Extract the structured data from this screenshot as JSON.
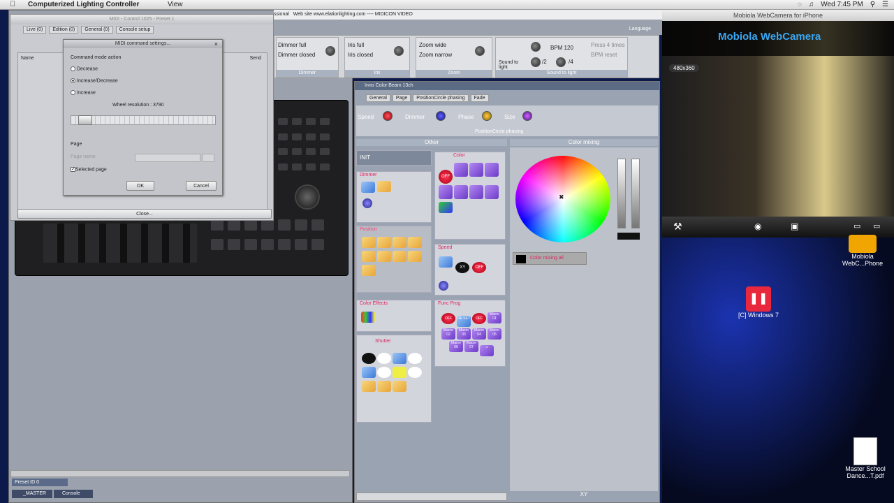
{
  "menubar": {
    "app": "Computerized Lighting Controller",
    "view": "View",
    "clock": "Wed 7:45 PM"
  },
  "midi_window": {
    "title": "MIDI - Control 1025 - Preset 1",
    "tabs": [
      "Live (0)",
      "Edition (0)",
      "General (0)",
      "Console setup"
    ],
    "col_name": "Name",
    "col_send": "Send",
    "close_label": "Close..."
  },
  "dialog": {
    "title": "MIDI command settings...",
    "section": "Command mode action",
    "options": [
      "Decrease",
      "Increase/Decrease",
      "Increase"
    ],
    "selected": 1,
    "resolution": "Wheel resolution : 3790",
    "slider_level": 0.12,
    "page_label": "Page",
    "page_name": "Page name",
    "selected_page": "Selected page",
    "ok": "OK",
    "cancel": "Cancel"
  },
  "topbar": {
    "left": "ssional",
    "site": "Web site  www.elationlighting.com ---- MIDICON VIDEO",
    "language": "Language"
  },
  "toolbar": {
    "dimmer_full": "Dimmer full",
    "dimmer_closed": "Dimmer closed",
    "dimmer": "Dimmer",
    "iris_full": "Iris full",
    "iris_closed": "Iris closed",
    "iris": "Iris",
    "zoom_wide": "Zoom wide",
    "zoom_narrow": "Zoom narrow",
    "zoom": "Zoom",
    "sound_to_light": "Sound to light",
    "bpm": "BPM 120",
    "press": "Press 4 times",
    "bpm_reset": "BPM reset",
    "s2": "/2",
    "s4": "/4",
    "sound_cap": "Sound to light"
  },
  "fx": {
    "title": "Inno Color Beam 13ch",
    "tabs": [
      "General",
      "Page",
      "PositionCircle phasing",
      "Fade"
    ],
    "params": [
      "Speed",
      "Dimmer",
      "Phase",
      "Size"
    ],
    "subtitle": "PositionCircle phasing",
    "other": "Other",
    "init": "INIT",
    "dimmer": "Dimmer",
    "position": "Position",
    "color_effects": "Color Effects",
    "shutter": "Shutter",
    "color": "Color",
    "speed": "Speed",
    "func_prog": "Func Prog",
    "color_mixing": "Color mixing",
    "color_mixing_all": "Color mixing all",
    "xy": "XY"
  },
  "func_labels": [
    "Macro 01",
    "Macro 02",
    "Macro 03",
    "Macro 04",
    "Macro 05",
    "Macro 06",
    "Macro 07"
  ],
  "off": "OFF",
  "reset": "RE SET",
  "xy_btn": "XY",
  "footer": {
    "preset": "Preset ID 0",
    "master": "_MASTER",
    "console": "Console"
  },
  "webcam": {
    "title": "Mobiola WebCamera for iPhone",
    "brand": "Mobiola WebCamera",
    "res": "480x360"
  },
  "desktop": {
    "item1": "Mobiola WebC...Phone",
    "item2": "[C] Windows 7",
    "item3": "Master School Dance...T.pdf"
  }
}
